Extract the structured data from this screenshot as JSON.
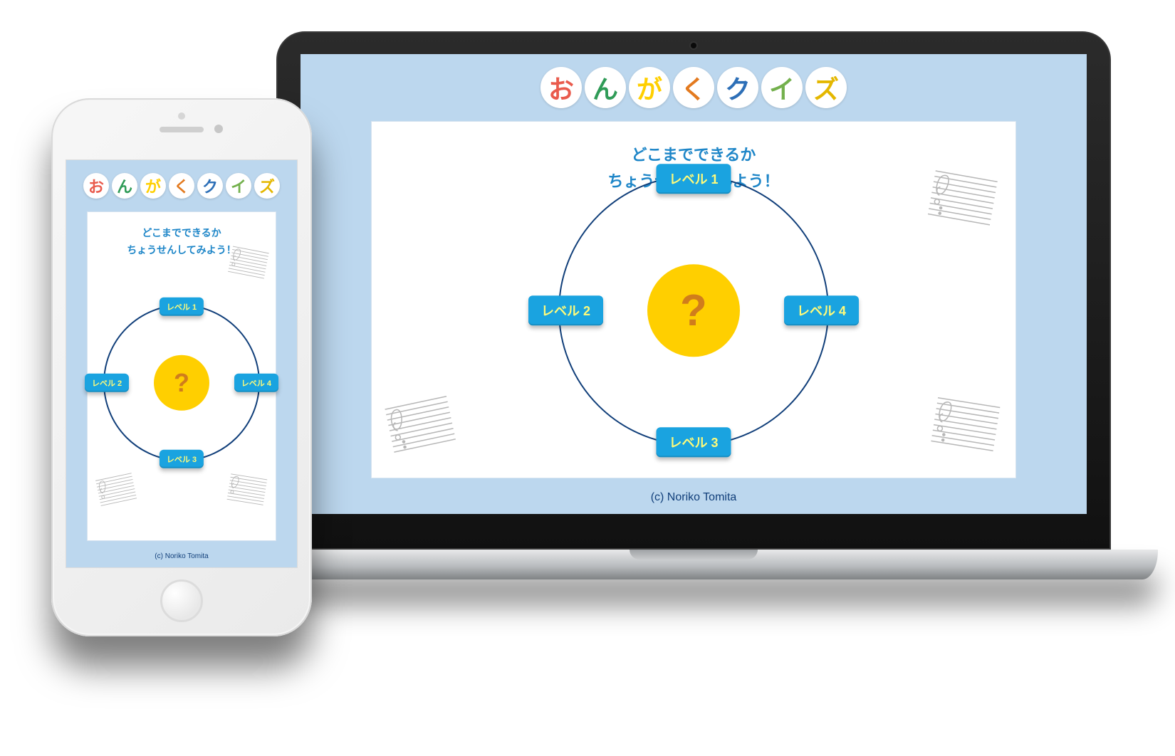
{
  "title_chars": [
    "お",
    "ん",
    "が",
    "く",
    "ク",
    "イ",
    "ズ"
  ],
  "subtitle_line1": "どこまでできるか",
  "subtitle_line2": "ちょうせんしてみよう！",
  "center_mark": "?",
  "levels": {
    "top": "レベル 1",
    "left": "レベル 2",
    "bottom": "レベル 3",
    "right": "レベル 4"
  },
  "credit": "(c) Noriko Tomita"
}
